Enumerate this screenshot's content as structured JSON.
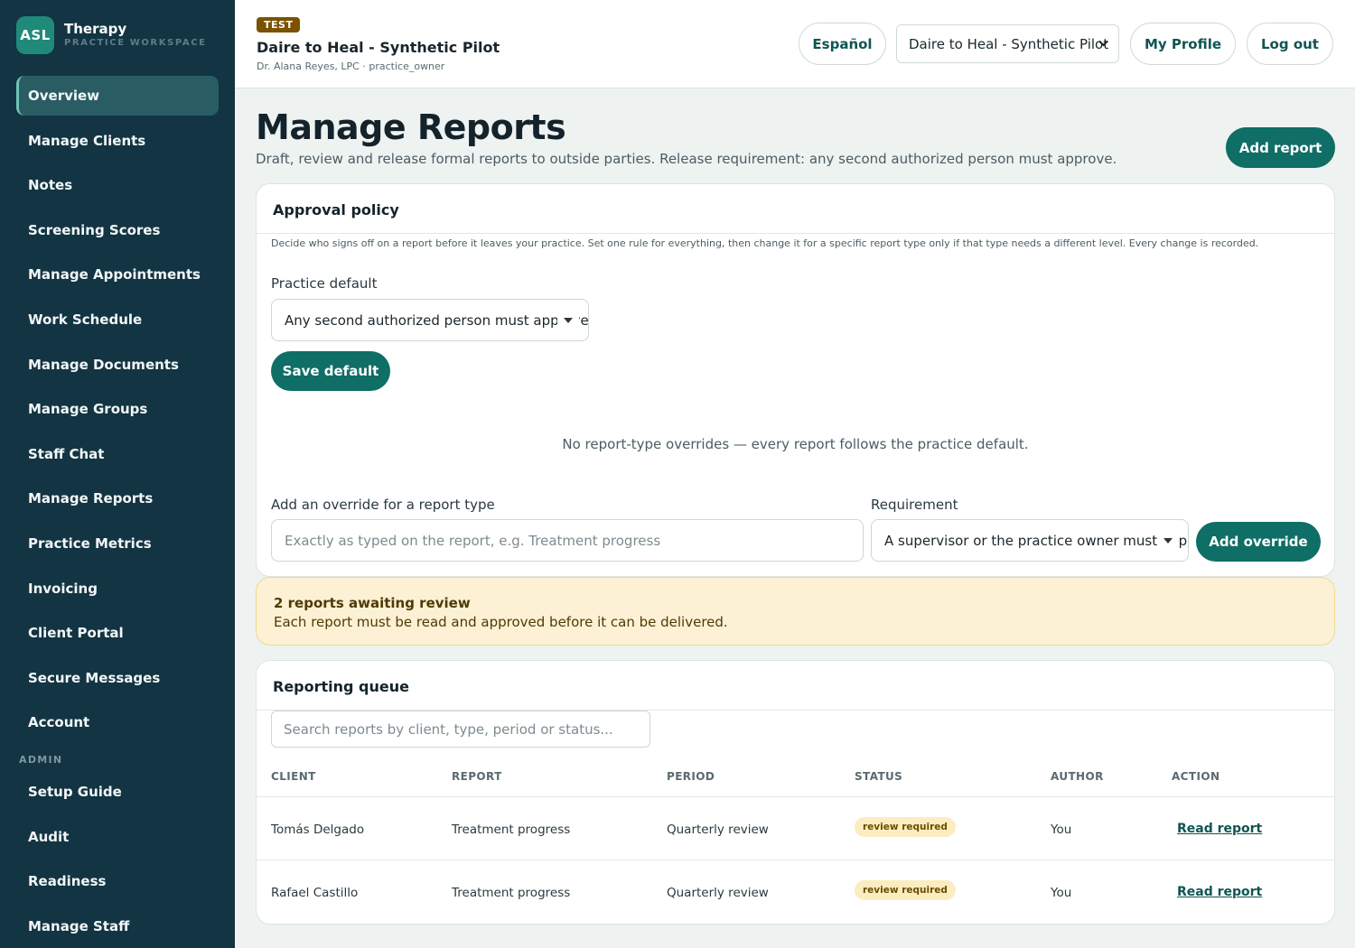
{
  "brand": {
    "logo": "ASL",
    "name": "Therapy",
    "subtitle": "PRACTICE WORKSPACE"
  },
  "sidebar": {
    "items": [
      {
        "label": "Overview",
        "active": true
      },
      {
        "label": "Manage Clients"
      },
      {
        "label": "Notes"
      },
      {
        "label": "Screening Scores"
      },
      {
        "label": "Manage Appointments"
      },
      {
        "label": "Work Schedule"
      },
      {
        "label": "Manage Documents"
      },
      {
        "label": "Manage Groups"
      },
      {
        "label": "Staff Chat"
      },
      {
        "label": "Manage Reports"
      },
      {
        "label": "Practice Metrics"
      },
      {
        "label": "Invoicing"
      },
      {
        "label": "Client Portal"
      },
      {
        "label": "Secure Messages"
      },
      {
        "label": "Account"
      }
    ],
    "admin_section": "ADMIN",
    "admin_items": [
      {
        "label": "Setup Guide"
      },
      {
        "label": "Audit"
      },
      {
        "label": "Readiness"
      },
      {
        "label": "Manage Staff"
      }
    ]
  },
  "header": {
    "badge": "TEST",
    "practice_name": "Daire to Heal - Synthetic Pilot",
    "user_line": "Dr. Alana Reyes, LPC · practice_owner",
    "language_button": "Español",
    "practice_select": "Daire to Heal - Synthetic Pilot",
    "profile_button": "My Profile",
    "logout_button": "Log out"
  },
  "page": {
    "title": "Manage Reports",
    "subtitle": "Draft, review and release formal reports to outside parties. Release requirement: any second authorized person must approve.",
    "add_button": "Add report"
  },
  "approval_policy": {
    "title": "Approval policy",
    "description": "Decide who signs off on a report before it leaves your practice. Set one rule for everything, then change it for a specific report type only if that type needs a different level. Every change is recorded.",
    "default_label": "Practice default",
    "default_value": "Any second authorized person must approve",
    "save_button": "Save default",
    "empty_message": "No report-type overrides — every report follows the practice default.",
    "override_label": "Add an override for a report type",
    "override_placeholder": "Exactly as typed on the report, e.g. Treatment progress",
    "requirement_label": "Requirement",
    "requirement_value": "A supervisor or the practice owner must approve",
    "add_override_button": "Add override"
  },
  "alert": {
    "title": "2 reports awaiting review",
    "text": "Each report must be read and approved before it can be delivered."
  },
  "queue": {
    "title": "Reporting queue",
    "search_placeholder": "Search reports by client, type, period or status...",
    "columns": [
      "CLIENT",
      "REPORT",
      "PERIOD",
      "STATUS",
      "AUTHOR",
      "ACTION"
    ],
    "rows": [
      {
        "client": "Tomás Delgado",
        "report": "Treatment progress",
        "period": "Quarterly review",
        "status": "review required",
        "author": "You",
        "action": "Read report"
      },
      {
        "client": "Rafael Castillo",
        "report": "Treatment progress",
        "period": "Quarterly review",
        "status": "review required",
        "author": "You",
        "action": "Read report"
      }
    ]
  },
  "colors": {
    "sidebar_bg": "#133442",
    "accent": "#0f6e66",
    "alert_bg": "#fcf1d4",
    "badge_bg": "#7a5200"
  }
}
